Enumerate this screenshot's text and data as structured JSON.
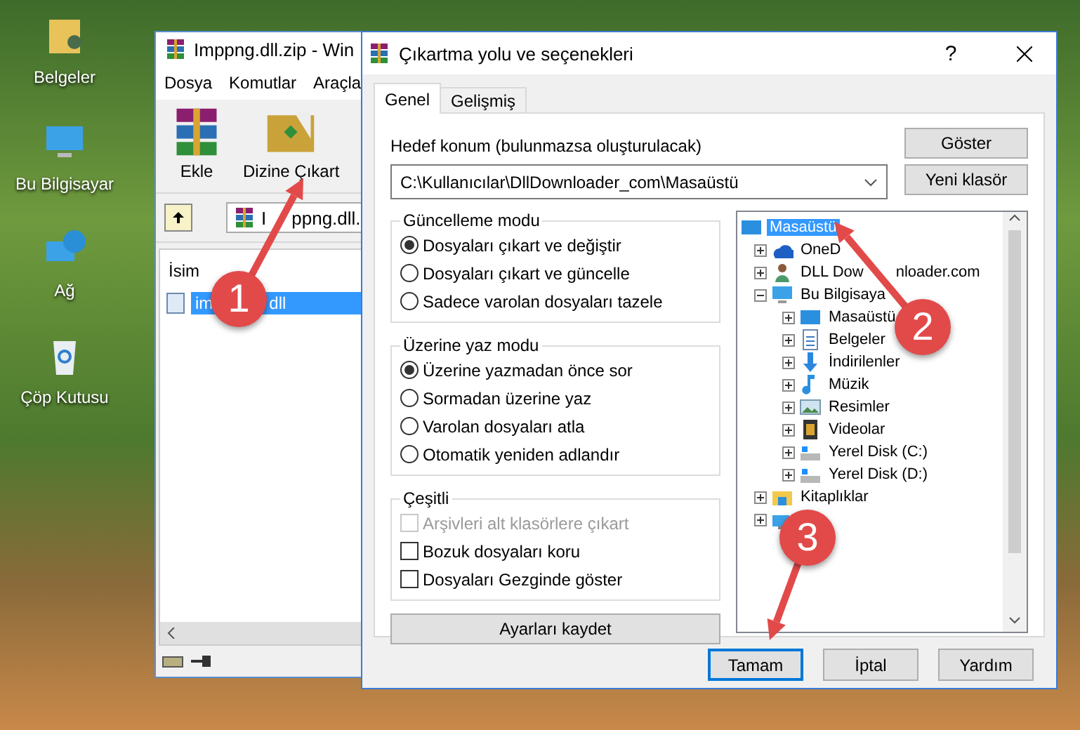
{
  "desktop": {
    "icons": [
      {
        "label": "Belgeler",
        "kind": "documents"
      },
      {
        "label": "Bu Bilgisayar",
        "kind": "computer"
      },
      {
        "label": "Ağ",
        "kind": "network"
      },
      {
        "label": "Çöp Kutusu",
        "kind": "recycle"
      }
    ]
  },
  "archiver": {
    "title": "Imppng.dll.zip - Win",
    "menu": [
      "Dosya",
      "Komutlar",
      "Araçla"
    ],
    "toolbar": [
      {
        "label": "Ekle",
        "kind": "add"
      },
      {
        "label": "Dizine Çıkart",
        "kind": "extract"
      }
    ],
    "address": "I",
    "address_tail": "ppng.dll.",
    "column": "İsim",
    "files": [
      {
        "name": "im",
        "name_tail": "dll",
        "selected": true
      }
    ]
  },
  "dialog": {
    "title": "Çıkartma yolu ve seçenekleri",
    "help": "?",
    "tabs": [
      {
        "label": "Genel",
        "selected": true
      },
      {
        "label": "Gelişmiş",
        "selected": false
      }
    ],
    "destination_label": "Hedef konum (bulunmazsa oluşturulacak)",
    "destination": "C:\\Kullanıcılar\\DllDownloader_com\\Masaüstü",
    "side_buttons": [
      "Göster",
      "Yeni klasör"
    ],
    "update_mode": {
      "title": "Güncelleme modu",
      "options": [
        {
          "label": "Dosyaları çıkart ve değiştir",
          "selected": true
        },
        {
          "label": "Dosyaları çıkart ve güncelle",
          "selected": false
        },
        {
          "label": "Sadece varolan dosyaları tazele",
          "selected": false
        }
      ]
    },
    "overwrite_mode": {
      "title": "Üzerine yaz modu",
      "options": [
        {
          "label": "Üzerine yazmadan önce sor",
          "selected": true
        },
        {
          "label": "Sormadan üzerine yaz",
          "selected": false
        },
        {
          "label": "Varolan dosyaları atla",
          "selected": false
        },
        {
          "label": "Otomatik yeniden adlandır",
          "selected": false
        }
      ]
    },
    "misc": {
      "title": "Çeşitli",
      "options": [
        {
          "label": "Arşivleri alt klasörlere çıkart",
          "checked": false,
          "disabled": true
        },
        {
          "label": "Bozuk dosyaları koru",
          "checked": false,
          "disabled": false
        },
        {
          "label": "Dosyaları Gezginde göster",
          "checked": false,
          "disabled": false
        }
      ]
    },
    "save_button": "Ayarları kaydet",
    "tree": {
      "root": {
        "label": "Masaüstü",
        "selected": true
      },
      "items": [
        {
          "label": "OneD",
          "kind": "cloud",
          "expanded": false,
          "selected": false
        },
        {
          "label": "DLL Dow",
          "label_tail": "nloader.com",
          "kind": "person",
          "expanded": false,
          "selected": false
        },
        {
          "label": "Bu Bilgisaya",
          "kind": "computer",
          "expanded": true,
          "selected": false,
          "children": [
            {
              "label": "Masaüstü",
              "kind": "desktop",
              "expanded": false,
              "selected": false
            },
            {
              "label": "Belgeler",
              "kind": "document",
              "expanded": false,
              "selected": false
            },
            {
              "label": "İndirilenler",
              "kind": "download",
              "expanded": false,
              "selected": false
            },
            {
              "label": "Müzik",
              "kind": "music",
              "expanded": false,
              "selected": false
            },
            {
              "label": "Resimler",
              "kind": "picture",
              "expanded": false,
              "selected": false
            },
            {
              "label": "Videolar",
              "kind": "video",
              "expanded": false,
              "selected": false
            },
            {
              "label": "Yerel Disk (C:)",
              "kind": "drive",
              "expanded": false,
              "selected": false
            },
            {
              "label": "Yerel Disk (D:)",
              "kind": "drive",
              "expanded": false,
              "selected": false
            }
          ]
        },
        {
          "label": "Kitaplıklar",
          "kind": "library",
          "expanded": false,
          "selected": false
        },
        {
          "kind": "network",
          "expanded": false,
          "selected": false
        }
      ]
    },
    "buttons": [
      {
        "label": "Tamam",
        "selected": true
      },
      {
        "label": "İptal",
        "selected": false
      },
      {
        "label": "Yardım",
        "selected": false
      }
    ]
  },
  "callouts": [
    "1",
    "2",
    "3"
  ]
}
